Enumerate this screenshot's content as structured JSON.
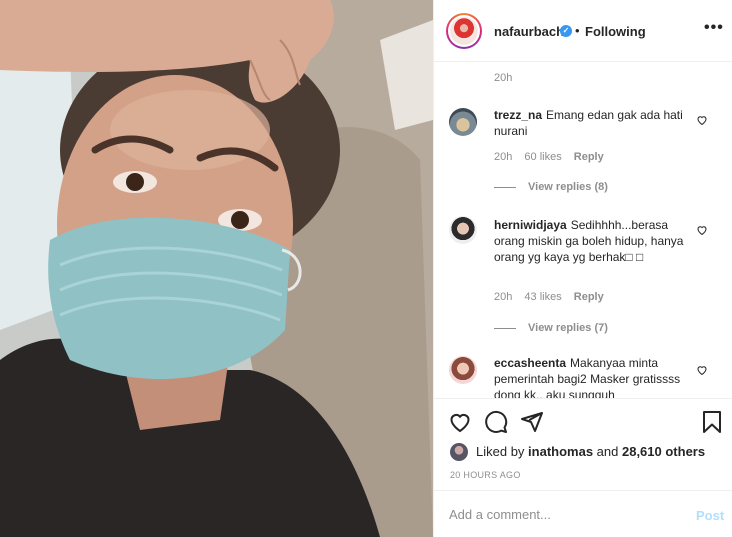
{
  "header": {
    "username": "nafaurbach",
    "verified_icon": "verified-badge-icon",
    "separator": "•",
    "follow_status": "Following",
    "more_icon": "more-options-icon"
  },
  "comments": {
    "top_timestamp": "20h",
    "items": [
      {
        "username": "trezz_na",
        "text": "Emang edan gak ada hati nurani",
        "time": "20h",
        "likes": "60 likes",
        "reply": "Reply",
        "view_replies": "View replies (8)"
      },
      {
        "username": "herniwidjaya",
        "text": "Sedihhhh...berasa orang miskin ga boleh hidup, hanya orang yg kaya yg berhak□ □",
        "time": "20h",
        "likes": "43 likes",
        "reply": "Reply",
        "view_replies": "View replies (7)"
      },
      {
        "username": "eccasheenta",
        "text": "Makanyaa minta pemerintah bagi2 Masker gratissss dong kk.. aku sungguh"
      }
    ]
  },
  "actions": {
    "icons": [
      "heart-icon",
      "comment-icon",
      "share-icon",
      "bookmark-icon"
    ],
    "liked_by_prefix": "Liked by ",
    "liked_by_user": "inathomas",
    "liked_by_middle": " and ",
    "liked_by_count": "28,610 others",
    "post_time": "20 HOURS AGO"
  },
  "add_comment": {
    "placeholder": "Add a comment...",
    "post_label": "Post"
  },
  "colors": {
    "link_blue": "#3897f0",
    "post_disabled": "#b2dffc",
    "muted": "#8e8e8e"
  }
}
